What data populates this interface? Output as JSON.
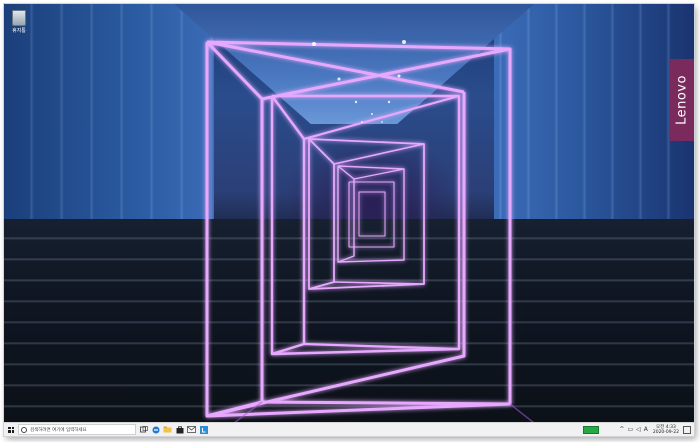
{
  "desktop": {
    "icons": [
      {
        "name": "recycle-bin",
        "label": "휴지통"
      }
    ],
    "brand": {
      "text": "Lenovo",
      "color": "#7a2a5d"
    },
    "neon_color": "#c86bff"
  },
  "taskbar": {
    "search": {
      "placeholder": "검색하려면 여기에 입력하세요"
    },
    "pinned_icons": [
      "task-view-icon",
      "edge-icon",
      "file-explorer-icon",
      "store-icon",
      "mail-icon",
      "app-icon"
    ],
    "tray": {
      "battery_color": "#28a745",
      "icons": [
        "chevron-up-icon",
        "network-icon",
        "volume-icon",
        "ime-icon"
      ],
      "ime_label": "A",
      "time": "오전 4:33",
      "date": "2020-09-22"
    }
  }
}
